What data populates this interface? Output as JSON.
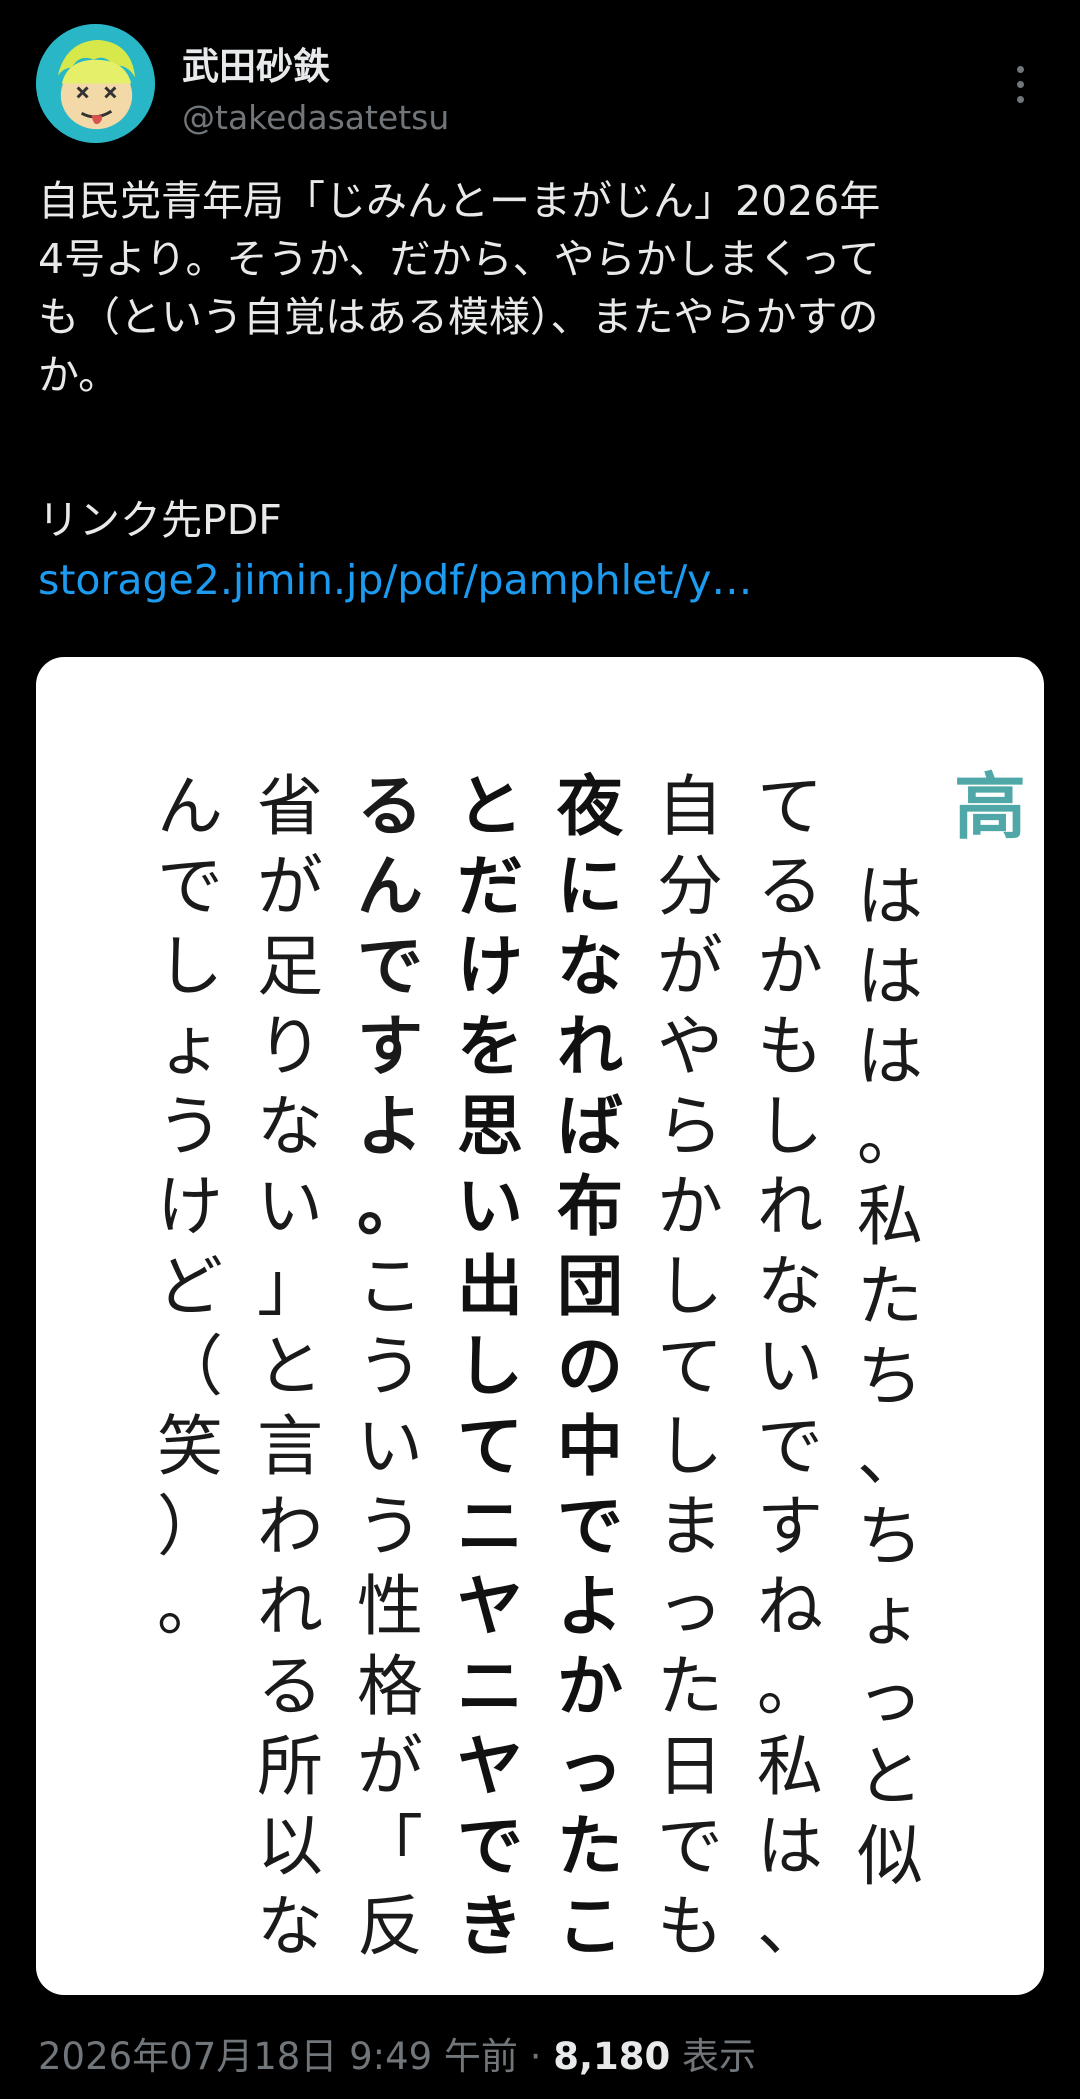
{
  "author": {
    "display_name": "武田砂鉄",
    "handle": "@takedasatetsu",
    "avatar_icon": "cartoon-face-icon"
  },
  "more_icon": "more-vertical-icon",
  "tweet": {
    "text": "自民党青年局「じみんとーまがじん」2026年\n4号より。そうか、だから、やらかしまくって\nも（という自覚はある模様）、またやらかすの\nか。",
    "link_label": "リンク先PDF",
    "link_text": "storage2.jimin.jp/pdf/pamphlet/y…"
  },
  "image": {
    "speaker": "高",
    "columns": [
      {
        "text": "ははは。私たち、ちょっと似",
        "bold": false
      },
      {
        "text": "てるかもしれないですね。私は、",
        "bold": false
      },
      {
        "text": "自分がやらかしてしまった日でも、",
        "bold": false
      },
      {
        "text": "夜になれば布団の中でよかったこ",
        "bold": true
      },
      {
        "text": "とだけを思い出してニヤニヤでき",
        "bold": true
      },
      {
        "text": "るんですよ。こういう性格が「反",
        "bold": "partial",
        "bold_count": 6
      },
      {
        "text": "省が足りない」と言われる所以な",
        "bold": false
      },
      {
        "text": "んでしょうけど（笑）。",
        "bold": false
      }
    ]
  },
  "meta": {
    "timestamp": "2026年07月18日 9:49 午前",
    "separator": "·",
    "views_count": "8,180",
    "views_label": "表示"
  }
}
